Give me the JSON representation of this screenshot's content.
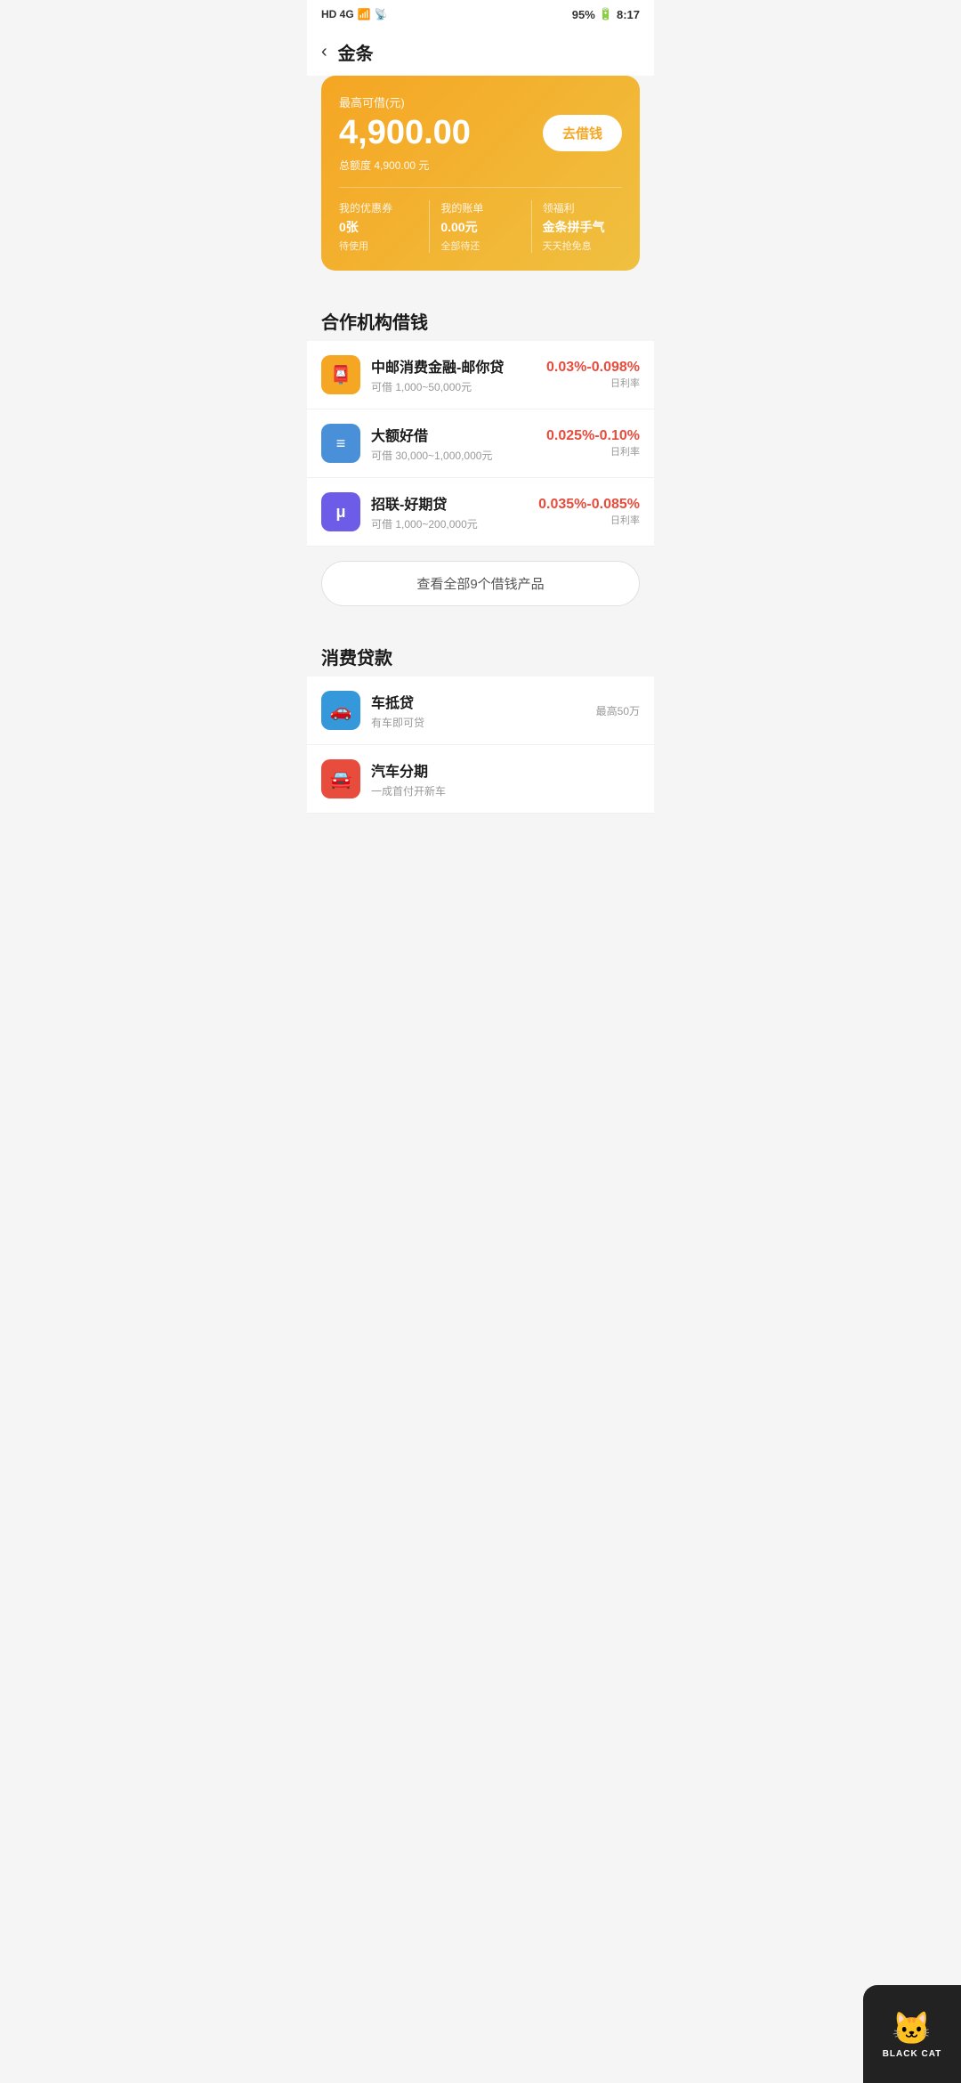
{
  "statusBar": {
    "left": "HD 4G",
    "battery": "95%",
    "time": "8:17"
  },
  "header": {
    "backLabel": "‹",
    "title": "金条"
  },
  "card": {
    "label": "最高可借(元)",
    "amount": "4,900.00",
    "totalLabel": "总额度 4,900.00 元",
    "borrowBtn": "去借钱",
    "actions": [
      {
        "title": "我的优惠券",
        "value": "0张",
        "sub": "待使用"
      },
      {
        "title": "我的账单",
        "value": "0.00元",
        "sub": "全部待还"
      },
      {
        "title": "领福利",
        "value": "金条拼手气",
        "sub": "天天抢免息"
      }
    ]
  },
  "sections": [
    {
      "title": "合作机构借钱",
      "items": [
        {
          "iconChar": "📮",
          "iconClass": "icon-orange",
          "name": "中邮消费金融-邮你贷",
          "desc": "可借 1,000~50,000元",
          "rate": "0.03%-0.098%",
          "rateLabel": "日利率"
        },
        {
          "iconChar": "💳",
          "iconClass": "icon-blue",
          "name": "大额好借",
          "desc": "可借 30,000~1,000,000元",
          "rate": "0.025%-0.10%",
          "rateLabel": "日利率"
        },
        {
          "iconChar": "μ",
          "iconClass": "icon-purple",
          "name": "招联-好期贷",
          "desc": "可借 1,000~200,000元",
          "rate": "0.035%-0.085%",
          "rateLabel": "日利率"
        }
      ],
      "viewAllBtn": "查看全部9个借钱产品"
    },
    {
      "title": "消费贷款",
      "items": [
        {
          "iconChar": "🚗",
          "iconClass": "icon-sky",
          "name": "车抵贷",
          "desc": "有车即可贷",
          "maxBadge": "最高50万"
        },
        {
          "iconChar": "🚘",
          "iconClass": "icon-red",
          "name": "汽车分期",
          "desc": "一成首付开新车",
          "maxBadge": ""
        }
      ]
    }
  ],
  "blackCat": {
    "label": "BLACK CAT"
  }
}
